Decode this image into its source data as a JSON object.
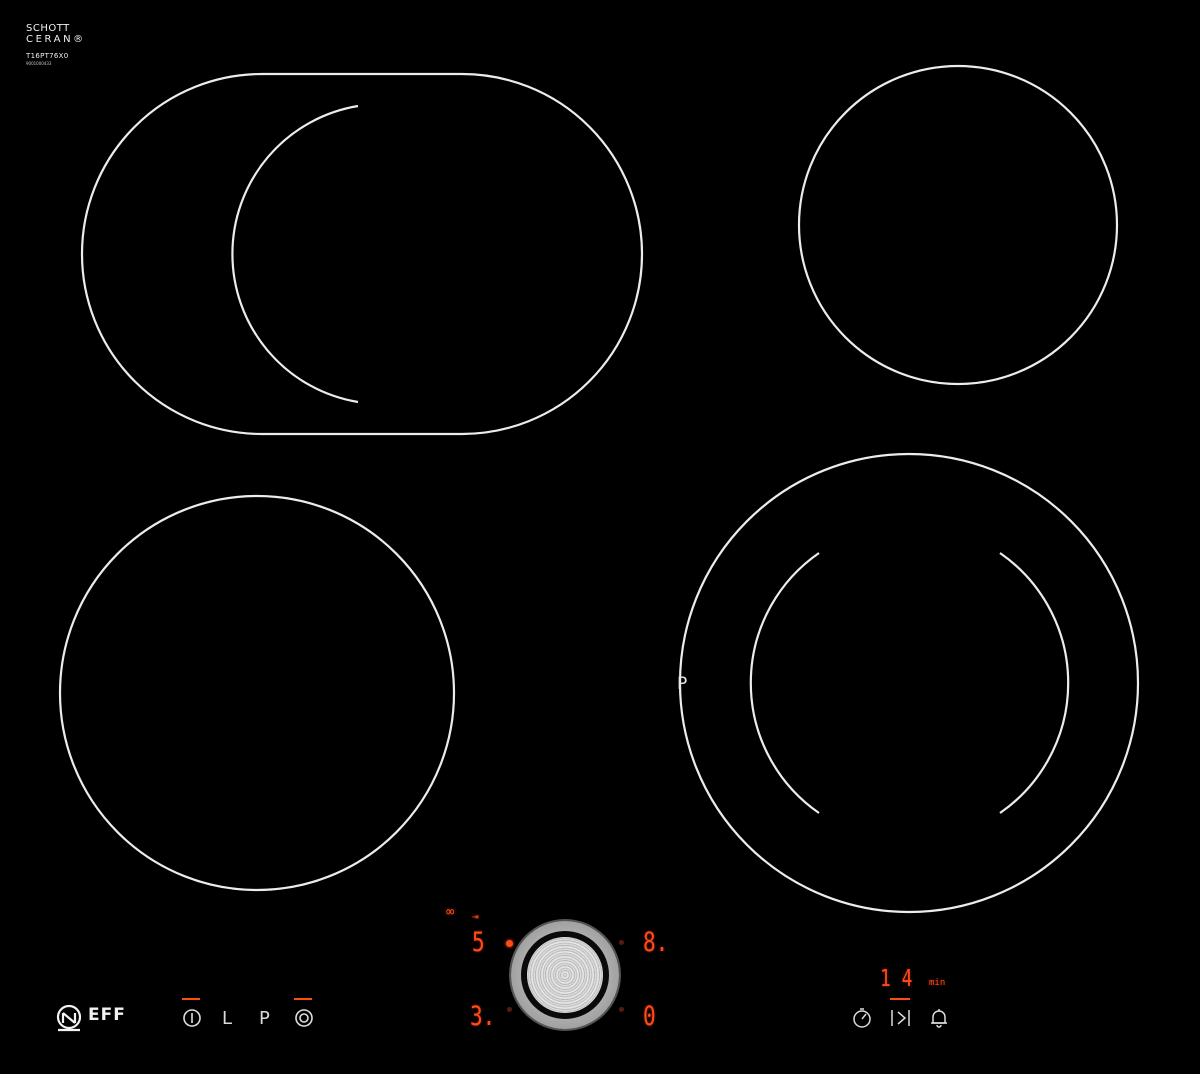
{
  "brand_top": {
    "line1": "SCHOTT",
    "line2": "CERAN®",
    "model": "T16PT76X0",
    "serial": "9001000433"
  },
  "zone_left_display": {
    "symbol_top": "∞",
    "symbol_extend": "⇥",
    "level": "5",
    "level_secondary": "3."
  },
  "zone_right_display": {
    "level": "8.",
    "level_secondary": "0"
  },
  "zone_marker": "P",
  "timer": {
    "value": "1 4",
    "unit": "min"
  },
  "left_controls": {
    "power_icon": "power-icon",
    "lock_label": "L",
    "program_label": "P",
    "rings_icon": "dual-ring-icon"
  },
  "right_controls": {
    "timer_icon": "stopwatch-icon",
    "next_icon": "skip-icon",
    "alarm_icon": "bell-icon"
  },
  "brand_bottom": {
    "logo_text": "EFF",
    "logo_icon": "neff-omega-icon"
  },
  "colors": {
    "glass": "#000000",
    "ring": "#ececec",
    "display": "#ff4a1a"
  }
}
